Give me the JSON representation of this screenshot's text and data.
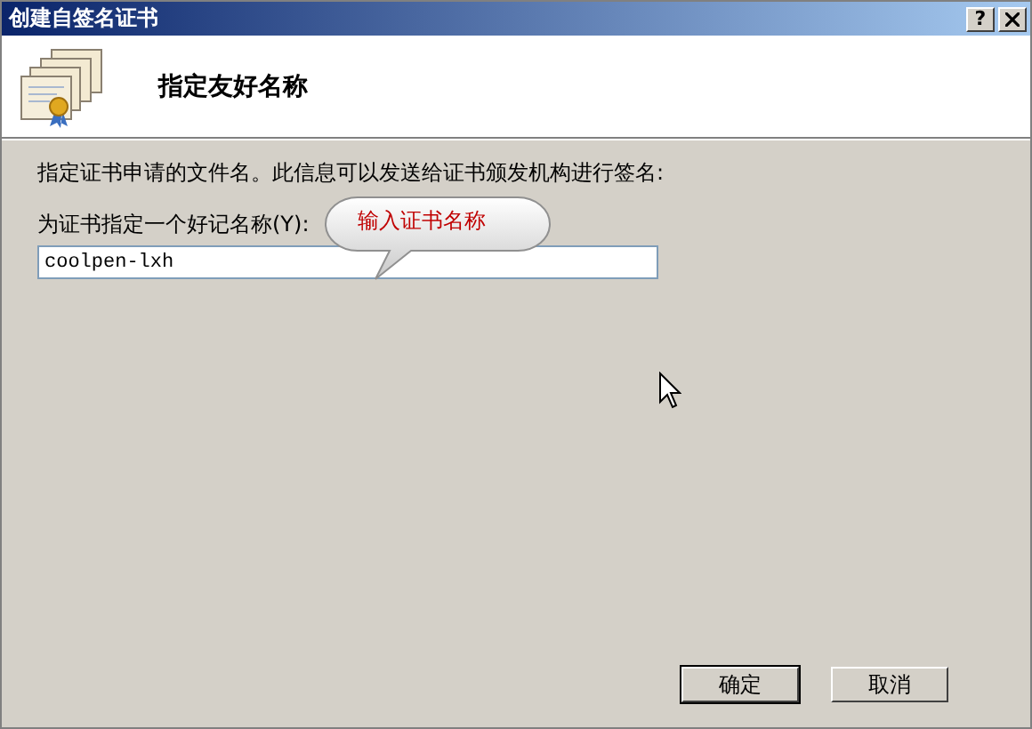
{
  "window": {
    "title": "创建自签名证书",
    "help": "?"
  },
  "header": {
    "title": "指定友好名称"
  },
  "body": {
    "description": "指定证书申请的文件名。此信息可以发送给证书颁发机构进行签名:",
    "field_label": "为证书指定一个好记名称(Y):",
    "field_value": "coolpen-lxh",
    "callout": "输入证书名称"
  },
  "buttons": [
    {
      "label": "确定",
      "default": true
    },
    {
      "label": "取消",
      "default": false
    }
  ]
}
